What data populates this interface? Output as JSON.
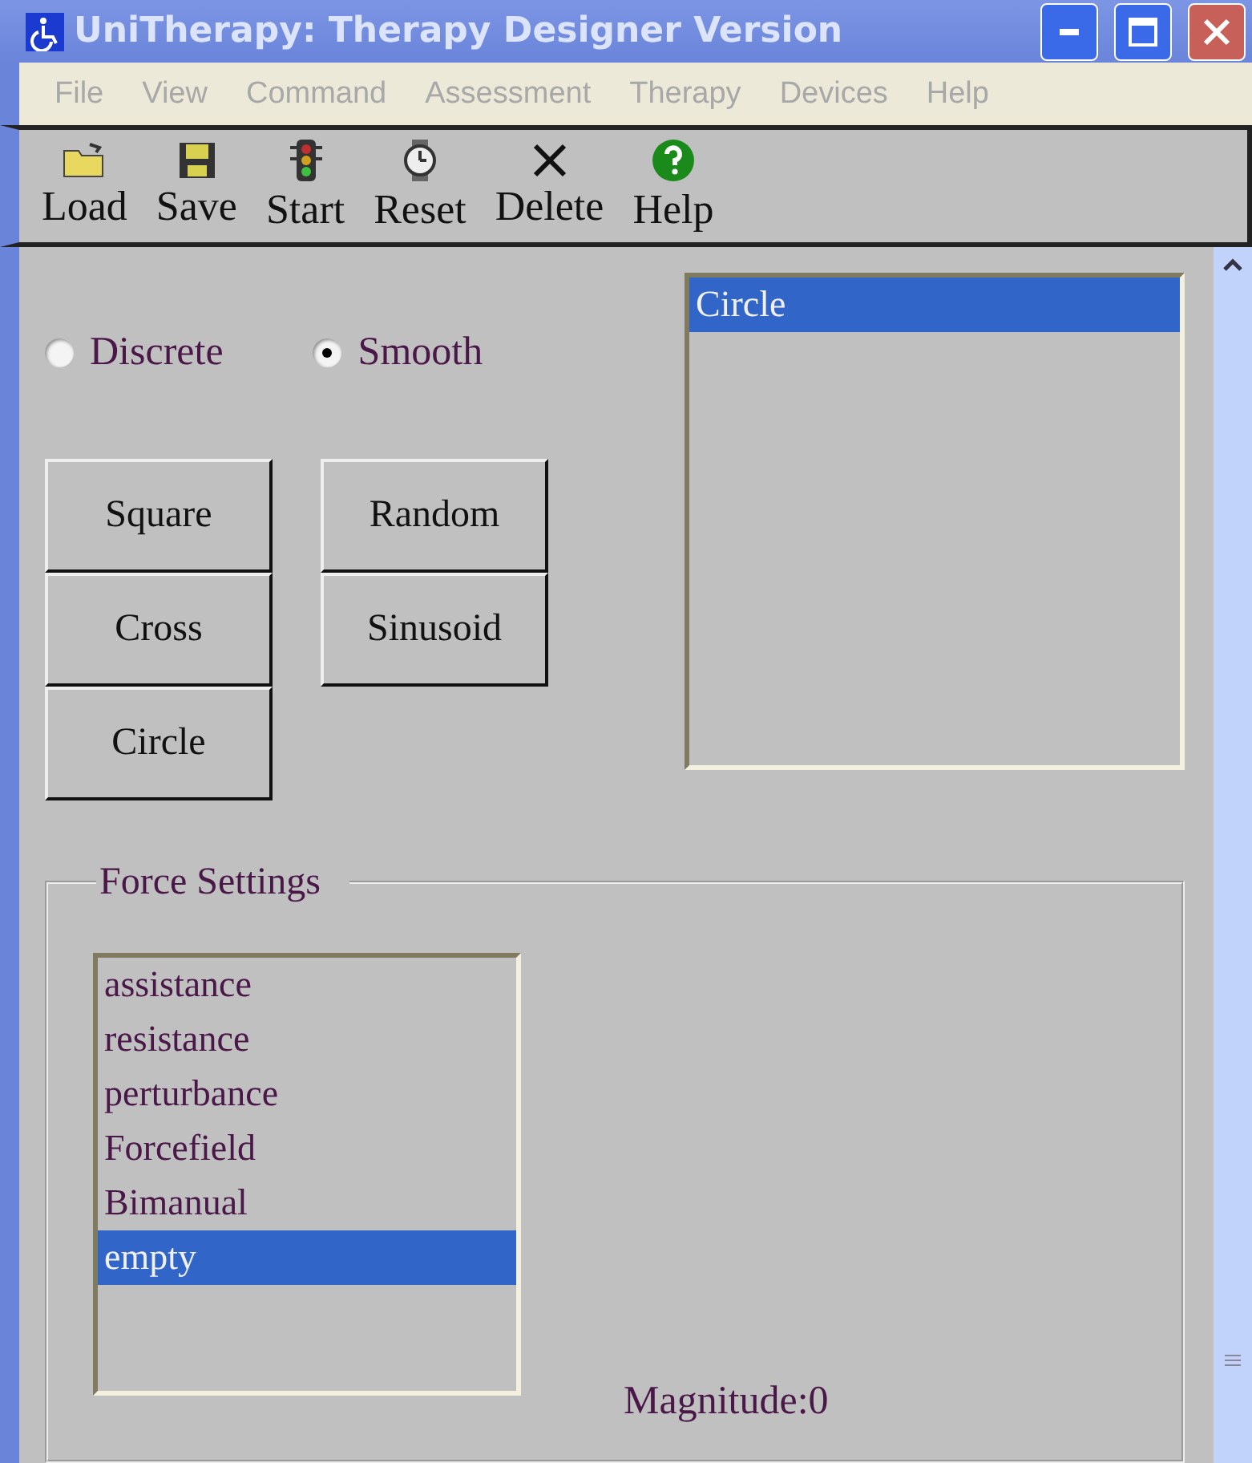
{
  "window": {
    "title": "UniTherapy: Therapy Designer Version"
  },
  "menu": [
    "File",
    "View",
    "Command",
    "Assessment",
    "Therapy",
    "Devices",
    "Help"
  ],
  "toolbar": [
    {
      "kind": "load",
      "label": "Load"
    },
    {
      "kind": "save",
      "label": "Save"
    },
    {
      "kind": "start",
      "label": "Start"
    },
    {
      "kind": "reset",
      "label": "Reset"
    },
    {
      "kind": "delete",
      "label": "Delete"
    },
    {
      "kind": "help",
      "label": "Help"
    }
  ],
  "mode": [
    {
      "label": "Discrete",
      "selected": false
    },
    {
      "label": "Smooth",
      "selected": true
    }
  ],
  "shape_buttons": [
    [
      "Square",
      "Cross",
      "Circle"
    ],
    [
      "Random",
      "Sinusoid"
    ]
  ],
  "shape_list": [
    {
      "label": "Circle",
      "selected": true
    }
  ],
  "force_settings": {
    "title": "Force Settings",
    "items": [
      {
        "label": "assistance",
        "selected": false
      },
      {
        "label": "resistance",
        "selected": false
      },
      {
        "label": "perturbance",
        "selected": false
      },
      {
        "label": "Forcefield",
        "selected": false
      },
      {
        "label": "Bimanual",
        "selected": false
      },
      {
        "label": "empty",
        "selected": true
      }
    ],
    "magnitude": "Magnitude:0"
  }
}
